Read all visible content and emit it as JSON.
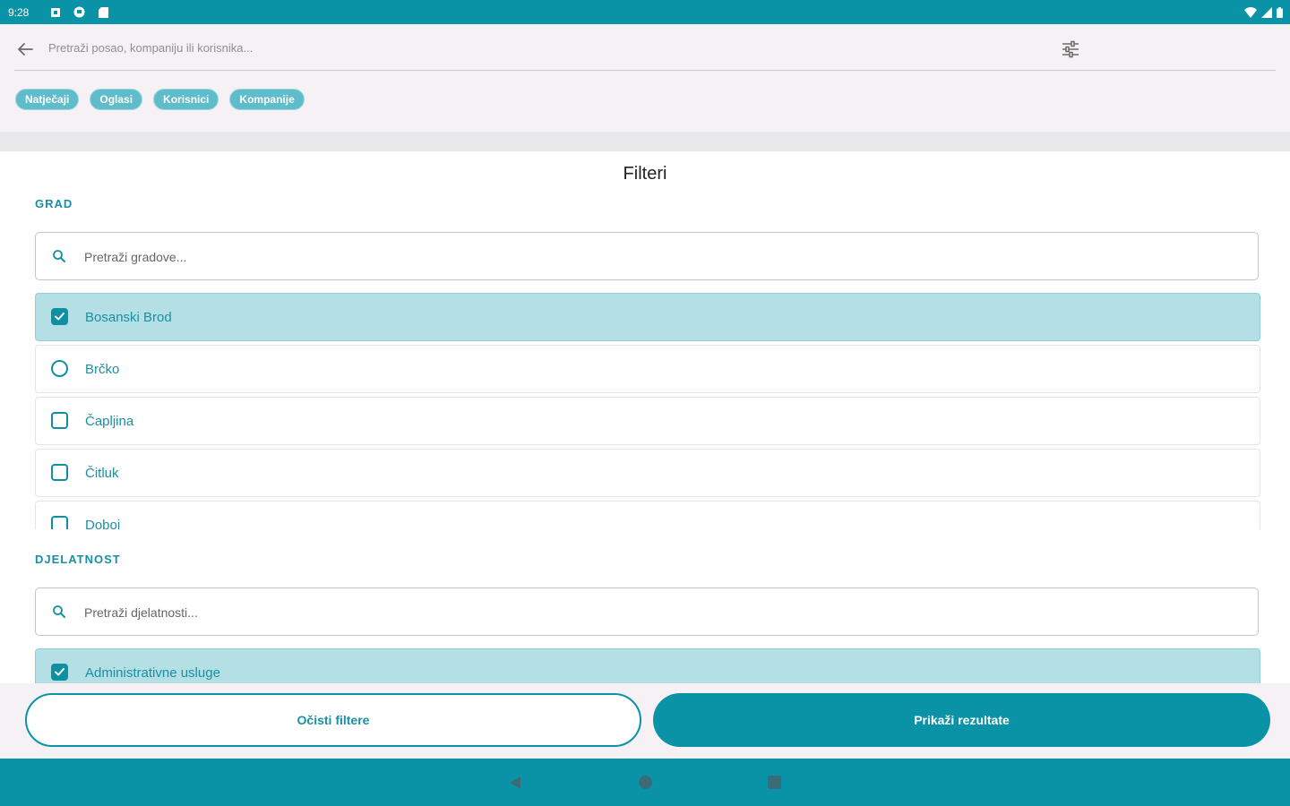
{
  "status_bar": {
    "time": "9:28",
    "icons_left": [
      "notification-icon",
      "pocket-icon",
      "sd-card-icon"
    ],
    "icons_right": [
      "wifi-icon",
      "signal-icon",
      "battery-icon"
    ]
  },
  "search": {
    "placeholder": "Pretraži posao, kompaniju ili korisnika..."
  },
  "chips": [
    "Natječaji",
    "Oglasi",
    "Korisnici",
    "Kompanije"
  ],
  "sheet": {
    "title": "Filteri",
    "grad": {
      "label": "GRAD",
      "search_placeholder": "Pretraži gradove...",
      "items": [
        {
          "label": "Bosanski Brod",
          "checked": true
        },
        {
          "label": "Brčko",
          "checked": false
        },
        {
          "label": "Čapljina",
          "checked": false
        },
        {
          "label": "Čitluk",
          "checked": false
        },
        {
          "label": "Doboj",
          "checked": false
        }
      ]
    },
    "djelatnost": {
      "label": "DJELATNOST",
      "search_placeholder": "Pretraži djelatnosti...",
      "items": [
        {
          "label": "Administrativne usluge",
          "checked": true
        }
      ]
    }
  },
  "buttons": {
    "clear": "Očisti filtere",
    "show": "Prikaži rezultate"
  },
  "colors": {
    "primary": "#0a93a6",
    "selected_row": "#b3dfe5"
  }
}
